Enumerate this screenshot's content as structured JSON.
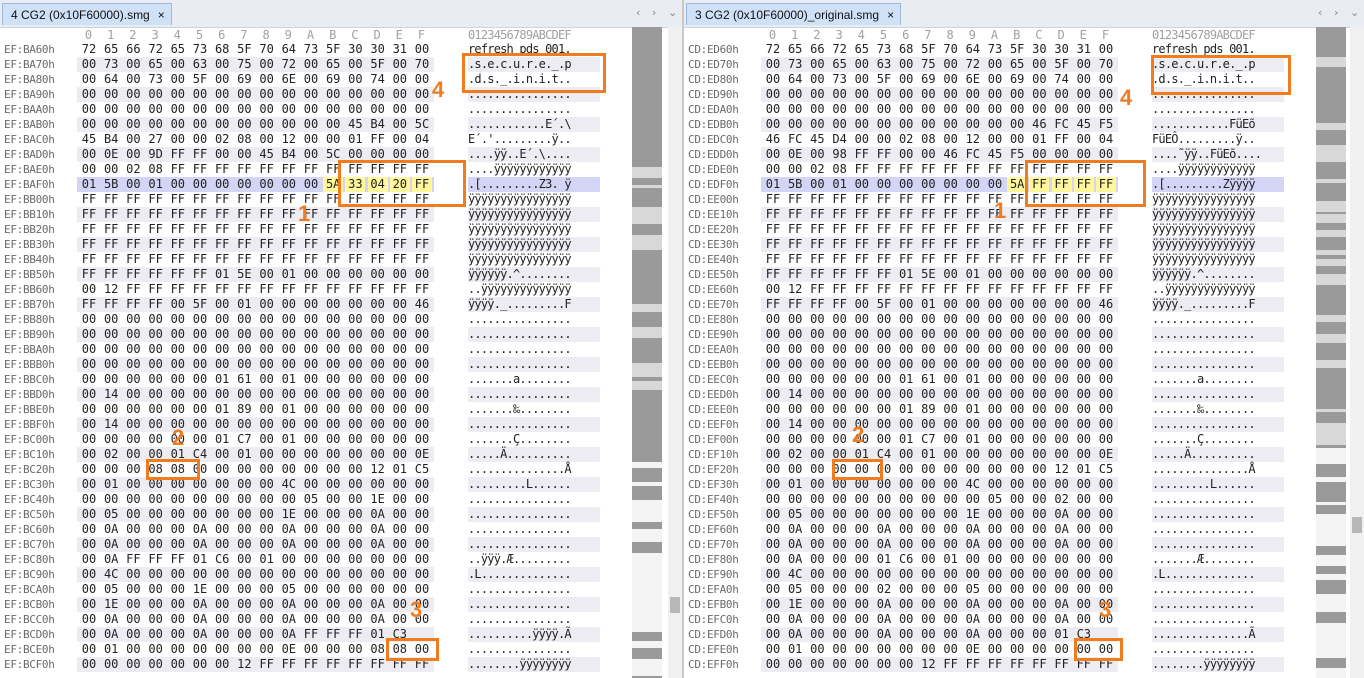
{
  "colors": {
    "annotation": "#f07c1f",
    "highlight": "#fff79a",
    "current_row": "#d4d4f6",
    "tab_bg": "#cfe1f7"
  },
  "hex_header": {
    "columns": [
      "0",
      "1",
      "2",
      "3",
      "4",
      "5",
      "6",
      "7",
      "8",
      "9",
      "A",
      "B",
      "C",
      "D",
      "E",
      "F"
    ],
    "ascii": "0123456789ABCDEF"
  },
  "panes": [
    {
      "tab": {
        "label": "4 CG2 (0x10F60000).smg",
        "close": "×",
        "nav_left": "‹",
        "nav_right": "›",
        "nav_menu": "⌄"
      },
      "rows": [
        {
          "addr": "EF:BA60h",
          "hex": "72 65 66 72 65 73 68 5F 70 64 73 5F 30 30 31 00",
          "ascii": "refresh_pds_001."
        },
        {
          "addr": "EF:BA70h",
          "hex": "00 73 00 65 00 63 00 75 00 72 00 65 00 5F 00 70",
          "ascii": ".s.e.c.u.r.e._.p"
        },
        {
          "addr": "EF:BA80h",
          "hex": "00 64 00 73 00 5F 00 69 00 6E 00 69 00 74 00 00",
          "ascii": ".d.s._.i.n.i.t.."
        },
        {
          "addr": "EF:BA90h",
          "hex": "00 00 00 00 00 00 00 00 00 00 00 00 00 00 00 00",
          "ascii": "................"
        },
        {
          "addr": "EF:BAA0h",
          "hex": "00 00 00 00 00 00 00 00 00 00 00 00 00 00 00 00",
          "ascii": "................"
        },
        {
          "addr": "EF:BAB0h",
          "hex": "00 00 00 00 00 00 00 00 00 00 00 00 45 B4 00 5C",
          "ascii": "............E´.\\"
        },
        {
          "addr": "EF:BAC0h",
          "hex": "45 B4 00 27 00 00 02 08 00 12 00 00 01 FF 00 04",
          "ascii": "E´.'.........ÿ.."
        },
        {
          "addr": "EF:BAD0h",
          "hex": "00 0E 00 9D FF FF 00 00 45 B4 00 5C 00 00 00 00",
          "ascii": "....ÿÿ..E´.\\...."
        },
        {
          "addr": "EF:BAE0h",
          "hex": "00 00 02 08 FF FF FF FF FF FF FF FF FF FF FF FF",
          "ascii": "....ÿÿÿÿÿÿÿÿÿÿÿÿ"
        },
        {
          "addr": "EF:BAF0h",
          "hex": "01 5B 00 01 00 00 00 00 00 00 00 5A 33 04 20 FF",
          "ascii": ".[.........Z3. ÿ"
        },
        {
          "addr": "EF:BB00h",
          "hex": "FF FF FF FF FF FF FF FF FF FF FF FF FF FF FF FF",
          "ascii": "ÿÿÿÿÿÿÿÿÿÿÿÿÿÿÿÿ"
        },
        {
          "addr": "EF:BB10h",
          "hex": "FF FF FF FF FF FF FF FF FF FF FF FF FF FF FF FF",
          "ascii": "ÿÿÿÿÿÿÿÿÿÿÿÿÿÿÿÿ"
        },
        {
          "addr": "EF:BB20h",
          "hex": "FF FF FF FF FF FF FF FF FF FF FF FF FF FF FF FF",
          "ascii": "ÿÿÿÿÿÿÿÿÿÿÿÿÿÿÿÿ"
        },
        {
          "addr": "EF:BB30h",
          "hex": "FF FF FF FF FF FF FF FF FF FF FF FF FF FF FF FF",
          "ascii": "ÿÿÿÿÿÿÿÿÿÿÿÿÿÿÿÿ"
        },
        {
          "addr": "EF:BB40h",
          "hex": "FF FF FF FF FF FF FF FF FF FF FF FF FF FF FF FF",
          "ascii": "ÿÿÿÿÿÿÿÿÿÿÿÿÿÿÿÿ"
        },
        {
          "addr": "EF:BB50h",
          "hex": "FF FF FF FF FF FF 01 5E 00 01 00 00 00 00 00 00",
          "ascii": "ÿÿÿÿÿÿ.^........"
        },
        {
          "addr": "EF:BB60h",
          "hex": "00 12 FF FF FF FF FF FF FF FF FF FF FF FF FF FF",
          "ascii": "..ÿÿÿÿÿÿÿÿÿÿÿÿÿÿ"
        },
        {
          "addr": "EF:BB70h",
          "hex": "FF FF FF FF 00 5F 00 01 00 00 00 00 00 00 00 46",
          "ascii": "ÿÿÿÿ._.........F"
        },
        {
          "addr": "EF:BB80h",
          "hex": "00 00 00 00 00 00 00 00 00 00 00 00 00 00 00 00",
          "ascii": "................"
        },
        {
          "addr": "EF:BB90h",
          "hex": "00 00 00 00 00 00 00 00 00 00 00 00 00 00 00 00",
          "ascii": "................"
        },
        {
          "addr": "EF:BBA0h",
          "hex": "00 00 00 00 00 00 00 00 00 00 00 00 00 00 00 00",
          "ascii": "................"
        },
        {
          "addr": "EF:BBB0h",
          "hex": "00 00 00 00 00 00 00 00 00 00 00 00 00 00 00 00",
          "ascii": "................"
        },
        {
          "addr": "EF:BBC0h",
          "hex": "00 00 00 00 00 00 01 61 00 01 00 00 00 00 00 00",
          "ascii": ".......a........"
        },
        {
          "addr": "EF:BBD0h",
          "hex": "00 14 00 00 00 00 00 00 00 00 00 00 00 00 00 00",
          "ascii": "................"
        },
        {
          "addr": "EF:BBE0h",
          "hex": "00 00 00 00 00 00 01 89 00 01 00 00 00 00 00 00",
          "ascii": ".......‰........"
        },
        {
          "addr": "EF:BBF0h",
          "hex": "00 14 00 00 00 00 00 00 00 00 00 00 00 00 00 00",
          "ascii": "................"
        },
        {
          "addr": "EF:BC00h",
          "hex": "00 00 00 00 00 00 01 C7 00 01 00 00 00 00 00 00",
          "ascii": ".......Ç........"
        },
        {
          "addr": "EF:BC10h",
          "hex": "00 02 00 00 01 C4 00 01 00 00 00 00 00 00 00 0E",
          "ascii": ".....Ä.........."
        },
        {
          "addr": "EF:BC20h",
          "hex": "00 00 00 08 08 00 00 00 00 00 00 00 00 12 01 C5",
          "ascii": "...............Å"
        },
        {
          "addr": "EF:BC30h",
          "hex": "00 01 00 00 00 00 00 00 00 4C 00 00 00 00 00 00",
          "ascii": ".........L......"
        },
        {
          "addr": "EF:BC40h",
          "hex": "00 00 00 00 00 00 00 00 00 00 05 00 00 1E 00 00",
          "ascii": "................"
        },
        {
          "addr": "EF:BC50h",
          "hex": "00 05 00 00 00 00 00 00 00 1E 00 00 00 0A 00 00",
          "ascii": "................"
        },
        {
          "addr": "EF:BC60h",
          "hex": "00 0A 00 00 00 0A 00 00 00 0A 00 00 00 0A 00 00",
          "ascii": "................"
        },
        {
          "addr": "EF:BC70h",
          "hex": "00 0A 00 00 00 0A 00 00 00 0A 00 00 00 0A 00 00",
          "ascii": "................"
        },
        {
          "addr": "EF:BC80h",
          "hex": "00 0A FF FF FF 01 C6 00 01 00 00 00 00 00 00 00",
          "ascii": "..ÿÿÿ.Æ........."
        },
        {
          "addr": "EF:BC90h",
          "hex": "00 4C 00 00 00 00 00 00 00 00 00 00 00 00 00 00",
          "ascii": ".L.............."
        },
        {
          "addr": "EF:BCA0h",
          "hex": "00 05 00 00 00 1E 00 00 00 05 00 00 00 00 00 00",
          "ascii": "................"
        },
        {
          "addr": "EF:BCB0h",
          "hex": "00 1E 00 00 00 0A 00 00 00 0A 00 00 00 0A 00 00",
          "ascii": "................"
        },
        {
          "addr": "EF:BCC0h",
          "hex": "00 0A 00 00 00 0A 00 00 00 0A 00 00 00 0A 00 00",
          "ascii": "................"
        },
        {
          "addr": "EF:BCD0h",
          "hex": "00 0A 00 00 00 0A 00 00 00 0A FF FF FF 01 C3",
          "ascii": "..........ÿÿÿÿ.Ã"
        },
        {
          "addr": "EF:BCE0h",
          "hex": "00 01 00 00 00 00 00 00 00 0E 00 00 00 08 08 00",
          "ascii": "................"
        },
        {
          "addr": "EF:BCF0h",
          "hex": "00 00 00 00 00 00 00 12 FF FF FF FF FF FF FF FF",
          "ascii": "........ÿÿÿÿÿÿÿÿ"
        }
      ]
    },
    {
      "tab": {
        "label": "3 CG2 (0x10F60000)_original.smg",
        "close": "×",
        "nav_left": "‹",
        "nav_right": "›",
        "nav_menu": "⌄"
      },
      "rows": [
        {
          "addr": "CD:ED60h",
          "hex": "72 65 66 72 65 73 68 5F 70 64 73 5F 30 30 31 00",
          "ascii": "refresh_pds_001."
        },
        {
          "addr": "CD:ED70h",
          "hex": "00 73 00 65 00 63 00 75 00 72 00 65 00 5F 00 70",
          "ascii": ".s.e.c.u.r.e._.p"
        },
        {
          "addr": "CD:ED80h",
          "hex": "00 64 00 73 00 5F 00 69 00 6E 00 69 00 74 00 00",
          "ascii": ".d.s._.i.n.i.t.."
        },
        {
          "addr": "CD:ED90h",
          "hex": "00 00 00 00 00 00 00 00 00 00 00 00 00 00 00 00",
          "ascii": "................"
        },
        {
          "addr": "CD:EDA0h",
          "hex": "00 00 00 00 00 00 00 00 00 00 00 00 00 00 00 00",
          "ascii": "................"
        },
        {
          "addr": "CD:EDB0h",
          "hex": "00 00 00 00 00 00 00 00 00 00 00 00 46 FC 45 F5",
          "ascii": "............FüEõ"
        },
        {
          "addr": "CD:EDC0h",
          "hex": "46 FC 45 D4 00 00 02 08 00 12 00 00 01 FF 00 04",
          "ascii": "FüEÔ.........ÿ.."
        },
        {
          "addr": "CD:EDD0h",
          "hex": "00 0E 00 98 FF FF 00 00 46 FC 45 F5 00 00 00 00",
          "ascii": "....˜ÿÿ..FüEõ...."
        },
        {
          "addr": "CD:EDE0h",
          "hex": "00 00 02 08 FF FF FF FF FF FF FF FF FF FF FF FF",
          "ascii": "....ÿÿÿÿÿÿÿÿÿÿÿÿ"
        },
        {
          "addr": "CD:EDF0h",
          "hex": "01 5B 00 01 00 00 00 00 00 00 00 5A FF FF FF FF",
          "ascii": ".[.........Zÿÿÿÿ"
        },
        {
          "addr": "CD:EE00h",
          "hex": "FF FF FF FF FF FF FF FF FF FF FF FF FF FF FF FF",
          "ascii": "ÿÿÿÿÿÿÿÿÿÿÿÿÿÿÿÿ"
        },
        {
          "addr": "CD:EE10h",
          "hex": "FF FF FF FF FF FF FF FF FF FF FF FF FF FF FF FF",
          "ascii": "ÿÿÿÿÿÿÿÿÿÿÿÿÿÿÿÿ"
        },
        {
          "addr": "CD:EE20h",
          "hex": "FF FF FF FF FF FF FF FF FF FF FF FF FF FF FF FF",
          "ascii": "ÿÿÿÿÿÿÿÿÿÿÿÿÿÿÿÿ"
        },
        {
          "addr": "CD:EE30h",
          "hex": "FF FF FF FF FF FF FF FF FF FF FF FF FF FF FF FF",
          "ascii": "ÿÿÿÿÿÿÿÿÿÿÿÿÿÿÿÿ"
        },
        {
          "addr": "CD:EE40h",
          "hex": "FF FF FF FF FF FF FF FF FF FF FF FF FF FF FF FF",
          "ascii": "ÿÿÿÿÿÿÿÿÿÿÿÿÿÿÿÿ"
        },
        {
          "addr": "CD:EE50h",
          "hex": "FF FF FF FF FF FF 01 5E 00 01 00 00 00 00 00 00",
          "ascii": "ÿÿÿÿÿÿ.^........"
        },
        {
          "addr": "CD:EE60h",
          "hex": "00 12 FF FF FF FF FF FF FF FF FF FF FF FF FF FF",
          "ascii": "..ÿÿÿÿÿÿÿÿÿÿÿÿÿÿ"
        },
        {
          "addr": "CD:EE70h",
          "hex": "FF FF FF FF 00 5F 00 01 00 00 00 00 00 00 00 46",
          "ascii": "ÿÿÿÿ._.........F"
        },
        {
          "addr": "CD:EE80h",
          "hex": "00 00 00 00 00 00 00 00 00 00 00 00 00 00 00 00",
          "ascii": "................"
        },
        {
          "addr": "CD:EE90h",
          "hex": "00 00 00 00 00 00 00 00 00 00 00 00 00 00 00 00",
          "ascii": "................"
        },
        {
          "addr": "CD:EEA0h",
          "hex": "00 00 00 00 00 00 00 00 00 00 00 00 00 00 00 00",
          "ascii": "................"
        },
        {
          "addr": "CD:EEB0h",
          "hex": "00 00 00 00 00 00 00 00 00 00 00 00 00 00 00 00",
          "ascii": "................"
        },
        {
          "addr": "CD:EEC0h",
          "hex": "00 00 00 00 00 00 01 61 00 01 00 00 00 00 00 00",
          "ascii": ".......a........"
        },
        {
          "addr": "CD:EED0h",
          "hex": "00 14 00 00 00 00 00 00 00 00 00 00 00 00 00 00",
          "ascii": "................"
        },
        {
          "addr": "CD:EEE0h",
          "hex": "00 00 00 00 00 00 01 89 00 01 00 00 00 00 00 00",
          "ascii": ".......‰........"
        },
        {
          "addr": "CD:EEF0h",
          "hex": "00 14 00 00 00 00 00 00 00 00 00 00 00 00 00 00",
          "ascii": "................"
        },
        {
          "addr": "CD:EF00h",
          "hex": "00 00 00 00 00 00 01 C7 00 01 00 00 00 00 00 00",
          "ascii": ".......Ç........"
        },
        {
          "addr": "CD:EF10h",
          "hex": "00 02 00 00 01 C4 00 01 00 00 00 00 00 00 00 0E",
          "ascii": ".....Ä.........."
        },
        {
          "addr": "CD:EF20h",
          "hex": "00 00 00 00 00 00 00 00 00 00 00 00 00 12 01 C5",
          "ascii": "...............Å"
        },
        {
          "addr": "CD:EF30h",
          "hex": "00 01 00 00 00 00 00 00 00 4C 00 00 00 00 00 00",
          "ascii": ".........L......"
        },
        {
          "addr": "CD:EF40h",
          "hex": "00 00 00 00 00 00 00 00 00 00 05 00 00 02 00 00",
          "ascii": "................"
        },
        {
          "addr": "CD:EF50h",
          "hex": "00 05 00 00 00 00 00 00 00 1E 00 00 00 0A 00 00",
          "ascii": "................"
        },
        {
          "addr": "CD:EF60h",
          "hex": "00 0A 00 00 00 0A 00 00 00 0A 00 00 00 0A 00 00",
          "ascii": "................"
        },
        {
          "addr": "CD:EF70h",
          "hex": "00 0A 00 00 00 0A 00 00 00 0A 00 00 00 0A 00 00",
          "ascii": "................"
        },
        {
          "addr": "CD:EF80h",
          "hex": "00 0A 00 00 00 01 C6 00 01 00 00 00 00 00 00 00",
          "ascii": ".......Æ........"
        },
        {
          "addr": "CD:EF90h",
          "hex": "00 4C 00 00 00 00 00 00 00 00 00 00 00 00 00 00",
          "ascii": ".L.............."
        },
        {
          "addr": "CD:EFA0h",
          "hex": "00 05 00 00 00 02 00 00 00 05 00 00 00 00 00 00",
          "ascii": "................"
        },
        {
          "addr": "CD:EFB0h",
          "hex": "00 1E 00 00 00 0A 00 00 00 0A 00 00 00 0A 00 00",
          "ascii": "................"
        },
        {
          "addr": "CD:EFC0h",
          "hex": "00 0A 00 00 00 0A 00 00 00 0A 00 00 00 0A 00 00",
          "ascii": "................"
        },
        {
          "addr": "CD:EFD0h",
          "hex": "00 0A 00 00 00 0A 00 00 00 0A 00 00 00 01 C3",
          "ascii": "...............Ã"
        },
        {
          "addr": "CD:EFE0h",
          "hex": "00 01 00 00 00 00 00 00 00 0E 00 00 00 00 00 00",
          "ascii": "................"
        },
        {
          "addr": "CD:EFF0h",
          "hex": "00 00 00 00 00 00 00 12 FF FF FF FF FF FF FF FF",
          "ascii": "........ÿÿÿÿÿÿÿÿ"
        }
      ]
    }
  ],
  "annotations": {
    "n1": "1",
    "n2": "2",
    "n3": "3",
    "n4": "4"
  }
}
